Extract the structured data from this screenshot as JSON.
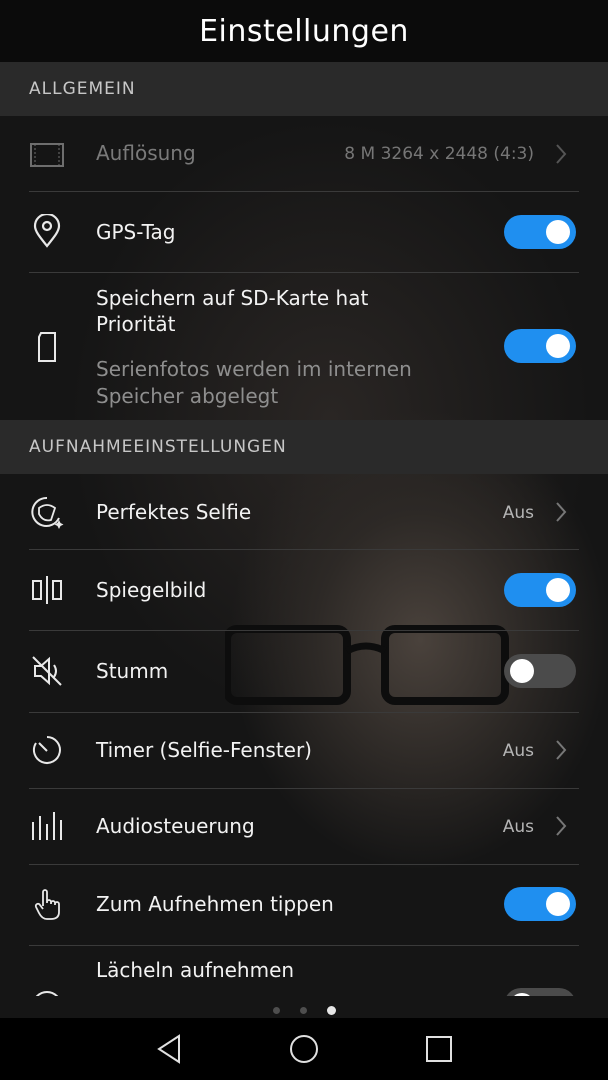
{
  "header": {
    "title": "Einstellungen"
  },
  "sections": {
    "general": "ALLGEMEIN",
    "capture": "AUFNAHMEEINSTELLUNGEN"
  },
  "settings": {
    "resolution": {
      "label": "Auflösung",
      "value": "8 M 3264 x 2448 (4:3)",
      "enabled": false
    },
    "gps": {
      "label": "GPS-Tag",
      "on": true
    },
    "sd": {
      "label_line1": "Speichern auf SD-Karte hat",
      "label_line2": "Priorität",
      "sub_line1": "Serienfotos werden im internen",
      "sub_line2": "Speicher abgelegt",
      "on": true
    },
    "selfie": {
      "label": "Perfektes Selfie",
      "value": "Aus"
    },
    "mirror": {
      "label": "Spiegelbild",
      "on": true
    },
    "mute": {
      "label": "Stumm",
      "on": false
    },
    "timer": {
      "label": "Timer (Selfie-Fenster)",
      "value": "Aus"
    },
    "audio": {
      "label": "Audiosteuerung",
      "value": "Aus"
    },
    "tap": {
      "label": "Zum Aufnehmen tippen",
      "on": true
    },
    "smile": {
      "label": "Lächeln aufnehmen",
      "on": false
    }
  },
  "pager": {
    "pages": 3,
    "active_page": 3
  },
  "navigation": {
    "back_icon": "back-triangle-icon",
    "home_icon": "home-circle-icon",
    "recents_icon": "recents-square-icon"
  },
  "colors": {
    "accent": "#1f8ff0",
    "toggle_off": "#4b4b4b",
    "section_header": "#2a2a2a"
  }
}
